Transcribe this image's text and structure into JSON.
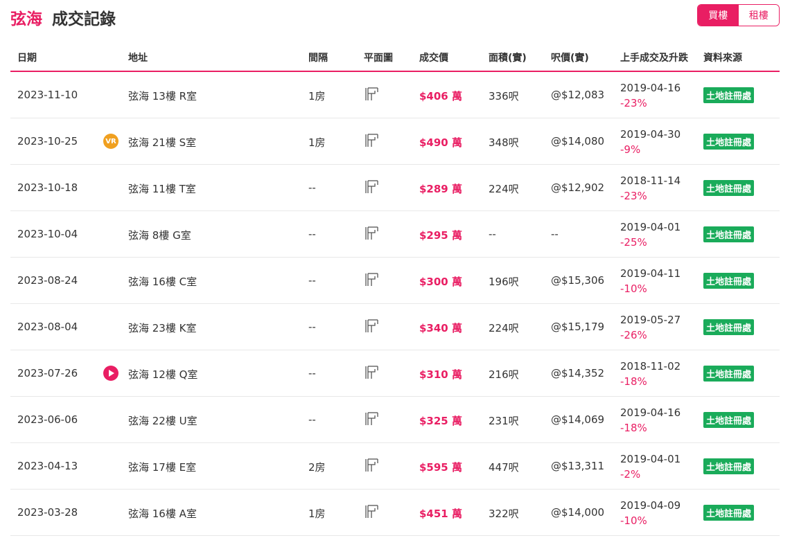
{
  "header": {
    "estate": "弦海",
    "title": "成交記錄",
    "buy": "買樓",
    "rent": "租樓"
  },
  "columns": {
    "date": "日期",
    "address": "地址",
    "rooms": "間隔",
    "floorplan": "平面圖",
    "price": "成交價",
    "area": "面積(實)",
    "unit_price": "呎價(實)",
    "prev": "上手成交及升跌",
    "source": "資料來源"
  },
  "rows": [
    {
      "date": "2023-11-10",
      "address": "弦海 13樓 R室",
      "rooms": "1房",
      "price": "$406 萬",
      "area": "336呎",
      "unit_price": "@$12,083",
      "prev_date": "2019-04-16",
      "prev_pct": "-23%",
      "source": "土地註冊處",
      "icon": ""
    },
    {
      "date": "2023-10-25",
      "address": "弦海 21樓 S室",
      "rooms": "1房",
      "price": "$490 萬",
      "area": "348呎",
      "unit_price": "@$14,080",
      "prev_date": "2019-04-30",
      "prev_pct": "-9%",
      "source": "土地註冊處",
      "icon": "VR"
    },
    {
      "date": "2023-10-18",
      "address": "弦海 11樓 T室",
      "rooms": "--",
      "price": "$289 萬",
      "area": "224呎",
      "unit_price": "@$12,902",
      "prev_date": "2018-11-14",
      "prev_pct": "-23%",
      "source": "土地註冊處",
      "icon": ""
    },
    {
      "date": "2023-10-04",
      "address": "弦海 8樓 G室",
      "rooms": "--",
      "price": "$295 萬",
      "area": "--",
      "unit_price": "--",
      "prev_date": "2019-04-01",
      "prev_pct": "-25%",
      "source": "土地註冊處",
      "icon": ""
    },
    {
      "date": "2023-08-24",
      "address": "弦海 16樓 C室",
      "rooms": "--",
      "price": "$300 萬",
      "area": "196呎",
      "unit_price": "@$15,306",
      "prev_date": "2019-04-11",
      "prev_pct": "-10%",
      "source": "土地註冊處",
      "icon": ""
    },
    {
      "date": "2023-08-04",
      "address": "弦海 23樓 K室",
      "rooms": "--",
      "price": "$340 萬",
      "area": "224呎",
      "unit_price": "@$15,179",
      "prev_date": "2019-05-27",
      "prev_pct": "-26%",
      "source": "土地註冊處",
      "icon": ""
    },
    {
      "date": "2023-07-26",
      "address": "弦海 12樓 Q室",
      "rooms": "--",
      "price": "$310 萬",
      "area": "216呎",
      "unit_price": "@$14,352",
      "prev_date": "2018-11-02",
      "prev_pct": "-18%",
      "source": "土地註冊處",
      "icon": "play"
    },
    {
      "date": "2023-06-06",
      "address": "弦海 22樓 U室",
      "rooms": "--",
      "price": "$325 萬",
      "area": "231呎",
      "unit_price": "@$14,069",
      "prev_date": "2019-04-16",
      "prev_pct": "-18%",
      "source": "土地註冊處",
      "icon": ""
    },
    {
      "date": "2023-04-13",
      "address": "弦海 17樓 E室",
      "rooms": "2房",
      "price": "$595 萬",
      "area": "447呎",
      "unit_price": "@$13,311",
      "prev_date": "2019-04-01",
      "prev_pct": "-2%",
      "source": "土地註冊處",
      "icon": ""
    },
    {
      "date": "2023-03-28",
      "address": "弦海 16樓 A室",
      "rooms": "1房",
      "price": "$451 萬",
      "area": "322呎",
      "unit_price": "@$14,000",
      "prev_date": "2019-04-09",
      "prev_pct": "-10%",
      "source": "土地註冊處",
      "icon": ""
    }
  ]
}
